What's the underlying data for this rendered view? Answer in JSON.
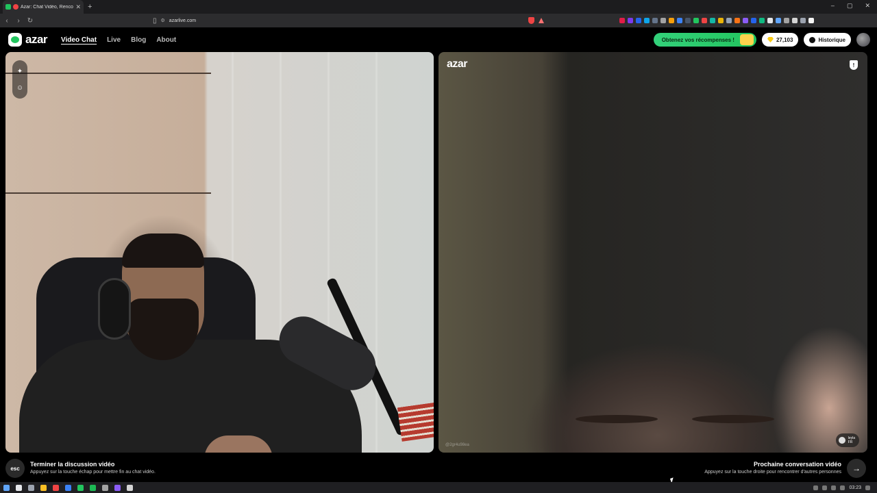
{
  "browser": {
    "tab_title": "Azar: Chat Vidéo, Rencontrer",
    "tab_close": "✕",
    "new_tab": "+",
    "url": "azarlive.com",
    "window_controls": [
      "–",
      "▢",
      "✕"
    ],
    "extension_colors": [
      "#e11d48",
      "#7c3aed",
      "#2563eb",
      "#0ea5e9",
      "#64748b",
      "#a3a3a3",
      "#f59e0b",
      "#3b82f6",
      "#475569",
      "#22c55e",
      "#ef4444",
      "#14b8a6",
      "#eab308",
      "#94a3b8",
      "#f97316",
      "#8b5cf6",
      "#2563eb",
      "#10b981",
      "#e5e7eb",
      "#60a5fa",
      "#a3a3a3",
      "#d4d4d4",
      "#9ca3af",
      "#f5f5f5"
    ]
  },
  "header": {
    "logo_text": "azar",
    "nav": [
      {
        "label": "Video Chat",
        "active": true
      },
      {
        "label": "Live",
        "active": false
      },
      {
        "label": "Blog",
        "active": false
      },
      {
        "label": "About",
        "active": false
      }
    ],
    "rewards_label": "Obtenez vos récompenses !",
    "gems": "27,103",
    "history_label": "Historique"
  },
  "left_video": {
    "tools": [
      "✦",
      "☺"
    ]
  },
  "right_video": {
    "logo_text": "azar",
    "report_icon": "!",
    "watermark": "@2gr4u98ea",
    "partner_name": "leyla",
    "partner_country": "FR"
  },
  "controls": {
    "esc_label": "esc",
    "end_title": "Terminer la discussion vidéo",
    "end_hint": "Appuyez sur la touche échap pour mettre fin au chat vidéo.",
    "next_title": "Prochaine conversation vidéo",
    "next_hint": "Appuyez sur la touche droite pour rencontrer d'autres personnes",
    "next_arrow": "→"
  },
  "taskbar": {
    "icon_colors": [
      "#60a5fa",
      "#e5e7eb",
      "#9ca3af",
      "#fbbf24",
      "#ef4444",
      "#3b82f6",
      "#22c55e",
      "#1db954",
      "#a3a3a3",
      "#8b5cf6",
      "#d4d4d4"
    ],
    "time": "03:23"
  }
}
